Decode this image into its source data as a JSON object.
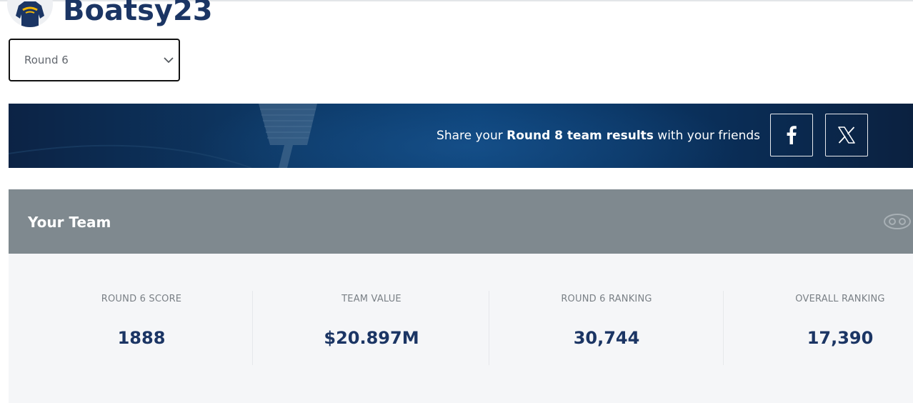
{
  "profile": {
    "username": "Boatsy23",
    "avatar_icon": "team-jersey-icon"
  },
  "round_selector": {
    "selected": "Round 6",
    "icon": "chevron-down-icon"
  },
  "share": {
    "prefix": "Share your ",
    "highlight": "Round 8 team results",
    "suffix": " with your friends",
    "facebook_label": "f",
    "facebook_icon": "facebook-icon",
    "x_icon": "x-logo-icon"
  },
  "team": {
    "title": "Your Team",
    "header_icon": "football-icon",
    "stats": [
      {
        "label": "ROUND 6 SCORE",
        "value": "1888"
      },
      {
        "label": "TEAM VALUE",
        "value": "$20.897M"
      },
      {
        "label": "ROUND 6 RANKING",
        "value": "30,744"
      },
      {
        "label": "OVERALL RANKING",
        "value": "17,390"
      }
    ]
  },
  "colors": {
    "brand_navy": "#1b3564",
    "header_gray": "#7f898f",
    "stats_bg": "#f5f6f8"
  }
}
